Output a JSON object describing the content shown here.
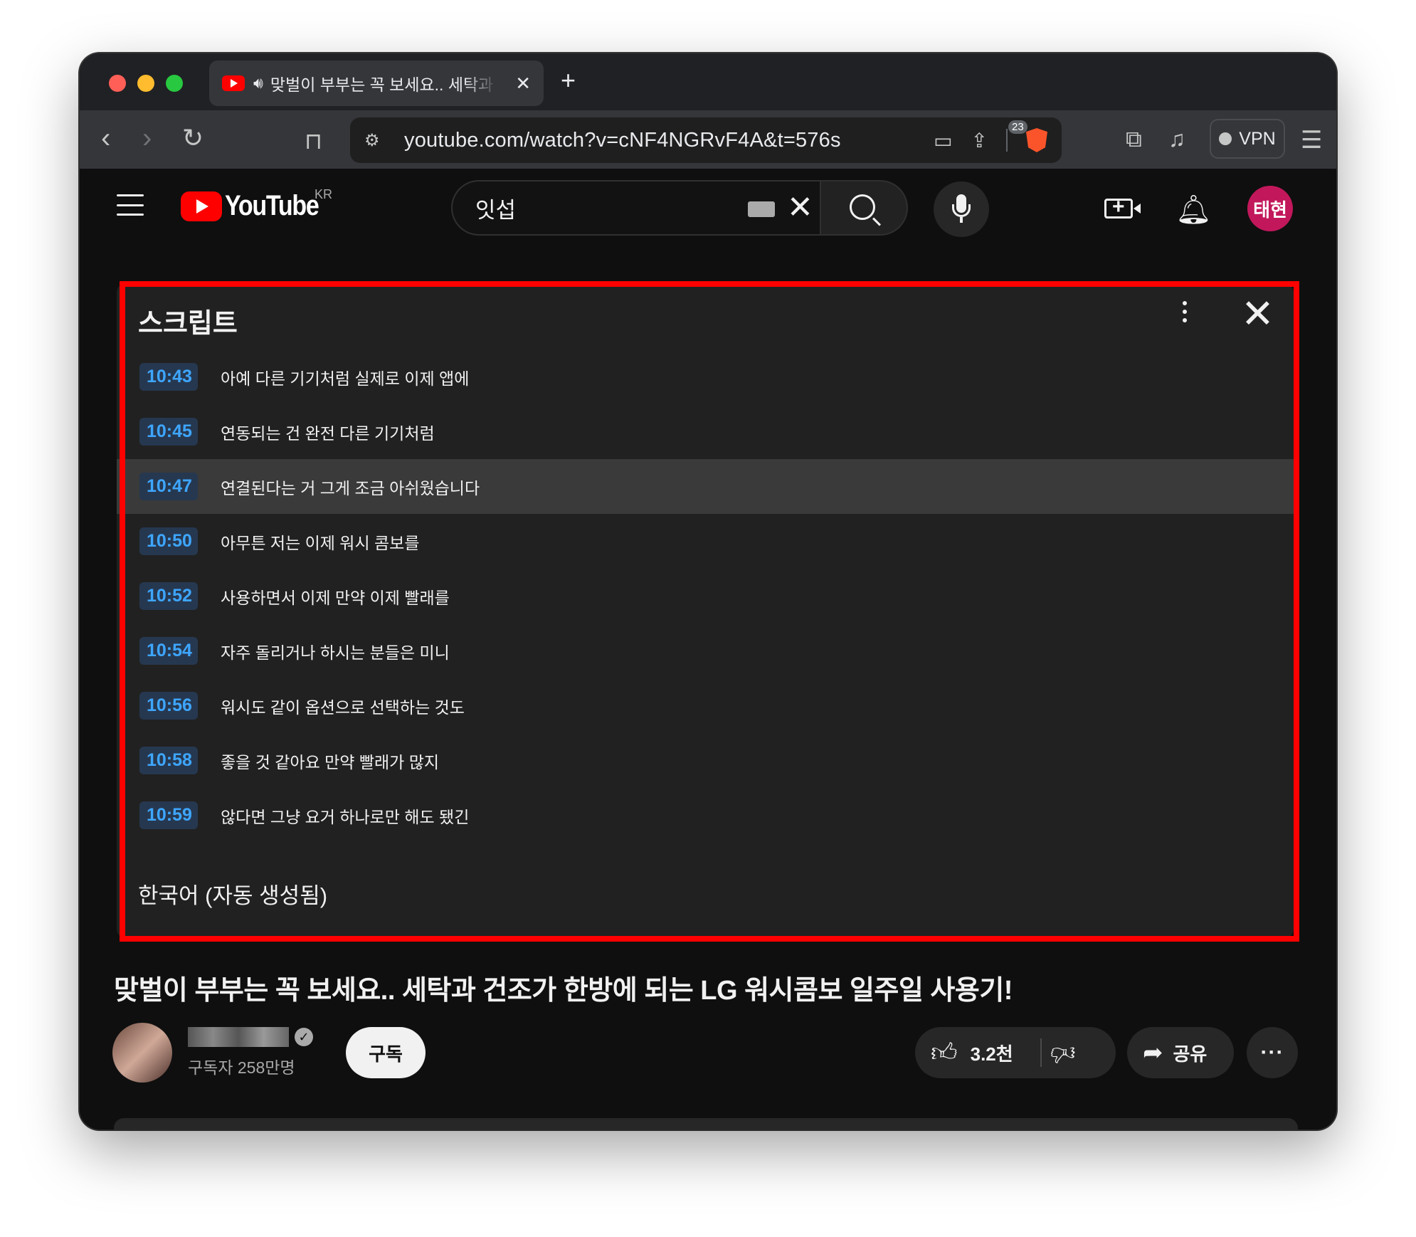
{
  "browser": {
    "tab": {
      "title": "맞벌이 부부는 꼭 보세요.. 세탁과 건조가 한방에 되는 LG 워시콤보 일주일 사용기!",
      "close": "✕"
    },
    "new_tab": "+",
    "url": "youtube.com/watch?v=cNF4NGRvF4A&t=576s",
    "brave_badge": "23",
    "vpn_label": "VPN"
  },
  "youtube": {
    "logo_text": "YouTube",
    "region": "KR",
    "search_value": "잇섭",
    "avatar_label": "태현"
  },
  "transcript": {
    "title": "스크립트",
    "segments": [
      {
        "time": "10:43",
        "text": "아예 다른 기기처럼 실제로 이제 앱에"
      },
      {
        "time": "10:45",
        "text": "연동되는 건 완전 다른 기기처럼"
      },
      {
        "time": "10:47",
        "text": "연결된다는 거 그게 조금 아쉬웠습니다"
      },
      {
        "time": "10:50",
        "text": "아무튼 저는 이제 워시 콤보를"
      },
      {
        "time": "10:52",
        "text": "사용하면서 이제 만약 이제 빨래를"
      },
      {
        "time": "10:54",
        "text": "자주 돌리거나 하시는 분들은 미니"
      },
      {
        "time": "10:56",
        "text": "워시도 같이 옵션으로 선택하는 것도"
      },
      {
        "time": "10:58",
        "text": "좋을 것 같아요 만약 빨래가 많지"
      },
      {
        "time": "10:59",
        "text": "않다면 그냥 요거 하나로만 해도 됐긴"
      }
    ],
    "active_index": 2,
    "language": "한국어 (자동 생성됨)"
  },
  "video": {
    "title": "맞벌이 부부는 꼭 보세요.. 세탁과 건조가 한방에 되는 LG 워시콤보 일주일 사용기!",
    "subscribers": "구독자 258만명",
    "subscribe_label": "구독",
    "like_count": "3.2천",
    "share_label": "공유",
    "more_label": "···"
  },
  "colors": {
    "highlight": "#ff0000",
    "timestamp": "#3ea6ff",
    "avatar": "#c2185b"
  }
}
